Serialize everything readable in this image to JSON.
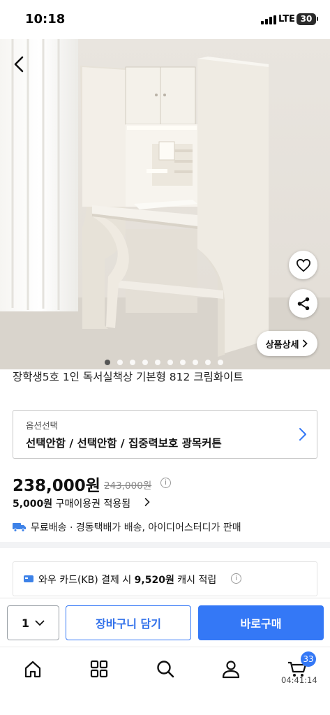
{
  "status_bar": {
    "time": "10:18",
    "network": "LTE",
    "battery": "30"
  },
  "product": {
    "title": "장학생5호 1인 독서실책상 기본형 812 크림화이트",
    "image_count": 10,
    "active_image_index": 0
  },
  "actions": {
    "detail_label": "상품상세",
    "detail_icon": "chevron-right-icon",
    "back_icon": "chevron-left-icon",
    "wishlist_icon": "heart-icon",
    "share_icon": "share-icon"
  },
  "option": {
    "label": "옵션선택",
    "value": "선택안함 / 선택안함 / 집중력보호 광목커튼"
  },
  "pricing": {
    "price": "238,000원",
    "original_price": "243,000원",
    "coupon_amount": "5,000원",
    "coupon_text": "구매이용권 적용됨"
  },
  "shipping": {
    "text": "무료배송 · 경동택배가 배송, 아이디어스터디가 판매",
    "icon": "truck-icon"
  },
  "card_benefit": {
    "prefix": "와우 카드(KB) 결제 시 ",
    "amount": "9,520원",
    "suffix": " 캐시 적립"
  },
  "purchase_bar": {
    "quantity": "1",
    "cart_label": "장바구니 담기",
    "buy_label": "바로구매"
  },
  "bottom_nav": {
    "items": [
      "home-icon",
      "categories-icon",
      "search-icon",
      "my-page-icon",
      "cart-icon"
    ],
    "cart_count": "33",
    "time": "04:41:14"
  },
  "colors": {
    "accent": "#3478f6",
    "shipping_icon": "#3d82e8"
  }
}
